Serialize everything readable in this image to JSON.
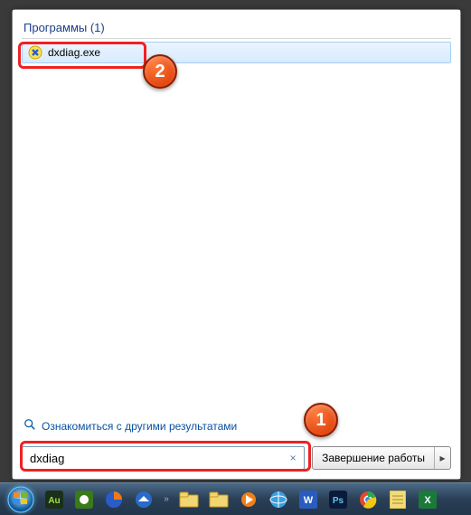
{
  "section": {
    "header": "Программы (1)"
  },
  "results": [
    {
      "label": "dxdiag.exe",
      "icon": "dxdiag-icon"
    }
  ],
  "more_results_label": "Ознакомиться с другими результатами",
  "search": {
    "value": "dxdiag",
    "clear_icon": "×"
  },
  "shutdown": {
    "label": "Завершение работы",
    "arrow": "▸"
  },
  "badges": {
    "one": "1",
    "two": "2"
  },
  "taskbar": {
    "chevron": "»",
    "icons": [
      "audition-icon",
      "camtasia-icon",
      "firefox-icon",
      "thunderbird-icon",
      "explorer-icon",
      "explorer2-icon",
      "media-icon",
      "globe-icon",
      "word-icon",
      "photoshop-icon",
      "chrome-icon",
      "notes-icon",
      "excel-icon"
    ]
  }
}
